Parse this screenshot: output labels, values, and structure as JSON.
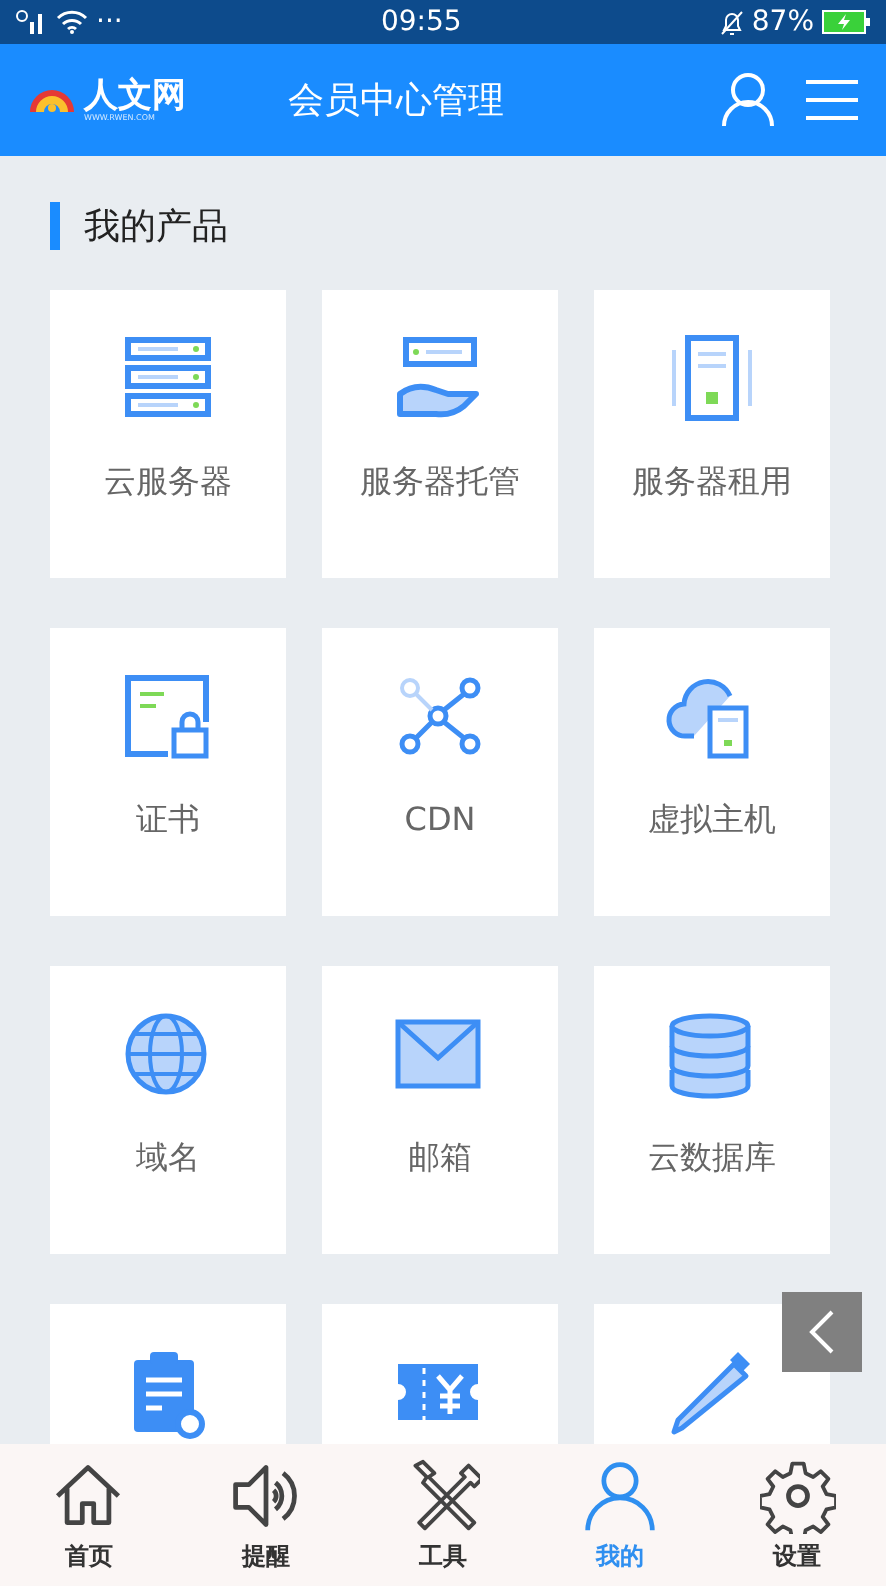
{
  "status_bar": {
    "more": "···",
    "time": "09:55",
    "battery": "87%"
  },
  "header": {
    "logo": "人文网",
    "logo_sub": "WWW.RWEN.COM",
    "title": "会员中心管理"
  },
  "section": {
    "title": "我的产品"
  },
  "products": [
    {
      "kind": "server-stack",
      "label": "云服务器"
    },
    {
      "kind": "hand-server",
      "label": "服务器托管"
    },
    {
      "kind": "server-tower",
      "label": "服务器租用"
    },
    {
      "kind": "certificate",
      "label": "证书"
    },
    {
      "kind": "network",
      "label": "CDN"
    },
    {
      "kind": "cloud-host",
      "label": "虚拟主机"
    },
    {
      "kind": "globe",
      "label": "域名"
    },
    {
      "kind": "mail",
      "label": "邮箱"
    },
    {
      "kind": "database",
      "label": "云数据库"
    },
    {
      "kind": "clipboard"
    },
    {
      "kind": "ticket"
    },
    {
      "kind": "pencil"
    }
  ],
  "tabs": [
    {
      "kind": "home",
      "label": "首页",
      "selected": false
    },
    {
      "kind": "speaker",
      "label": "提醒",
      "selected": false
    },
    {
      "kind": "tools",
      "label": "工具",
      "selected": false
    },
    {
      "kind": "person",
      "label": "我的",
      "selected": true
    },
    {
      "kind": "gear",
      "label": "设置",
      "selected": false
    }
  ]
}
